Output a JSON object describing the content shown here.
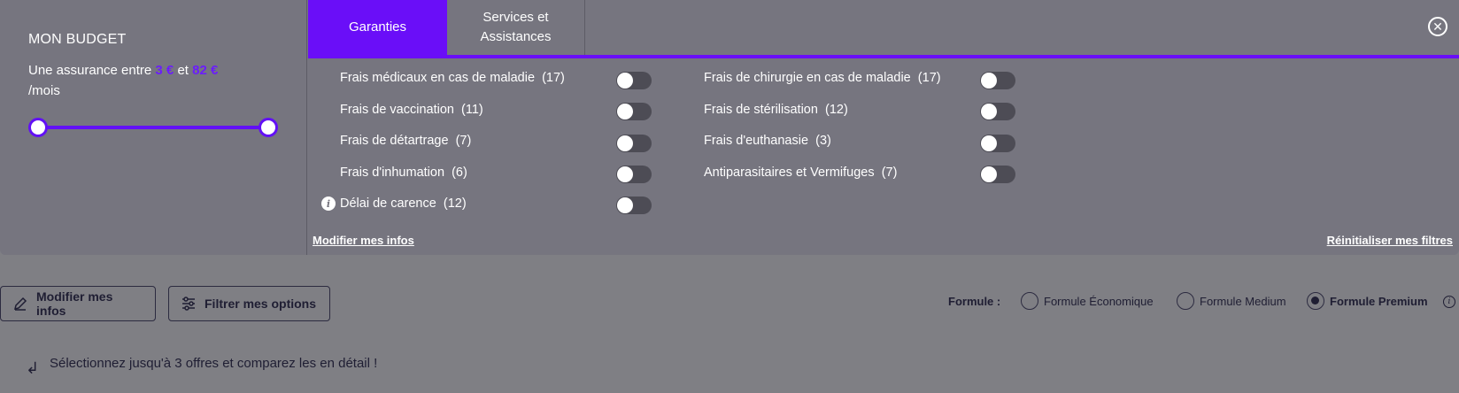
{
  "budget": {
    "title": "MON BUDGET",
    "text_prefix": "Une assurance entre",
    "min_amount": "3 €",
    "connector": "et",
    "max_amount": "82 €",
    "text_suffix": "/mois",
    "range_fraction": [
      0.0,
      1.0
    ]
  },
  "tabs": [
    {
      "label": "Garanties",
      "active": true
    },
    {
      "label": "Services et Assistances",
      "active": false
    }
  ],
  "filters": {
    "left": [
      {
        "label": "Frais médicaux en cas de maladie",
        "count": "(17)",
        "on": false
      },
      {
        "label": "Frais de vaccination",
        "count": "(11)",
        "on": false
      },
      {
        "label": "Frais de détartrage",
        "count": "(7)",
        "on": false
      },
      {
        "label": "Frais d'inhumation",
        "count": "(6)",
        "on": false
      },
      {
        "label": "Délai de carence",
        "count": "(12)",
        "on": false
      }
    ],
    "right": [
      {
        "label": "Frais de chirurgie en cas de maladie",
        "count": "(17)",
        "on": false
      },
      {
        "label": "Frais de stérilisation",
        "count": "(12)",
        "on": false
      },
      {
        "label": "Frais d'euthanasie",
        "count": "(3)",
        "on": false
      },
      {
        "label": "Antiparasitaires et Vermifuges",
        "count": "(7)",
        "on": false
      }
    ]
  },
  "links": {
    "modify": "Modifier mes infos",
    "reset": "Réinitialiser mes filtres"
  },
  "toolbar": {
    "modify_label": "Modifier mes infos",
    "filter_label": "Filtrer mes options",
    "formule_label": "Formule :",
    "formules": [
      {
        "label": "Formule Économique",
        "checked": false
      },
      {
        "label": "Formule Medium",
        "checked": false
      },
      {
        "label": "Formule Premium",
        "checked": true
      }
    ]
  },
  "compare": {
    "text": "Sélectionnez jusqu'à 3 offres et comparez les en détail !"
  },
  "colors": {
    "accent": "#6a0ef8",
    "panel_bg": "#76757f",
    "page_bg": "#7f7f84",
    "dark_text": "#1f1e33"
  }
}
